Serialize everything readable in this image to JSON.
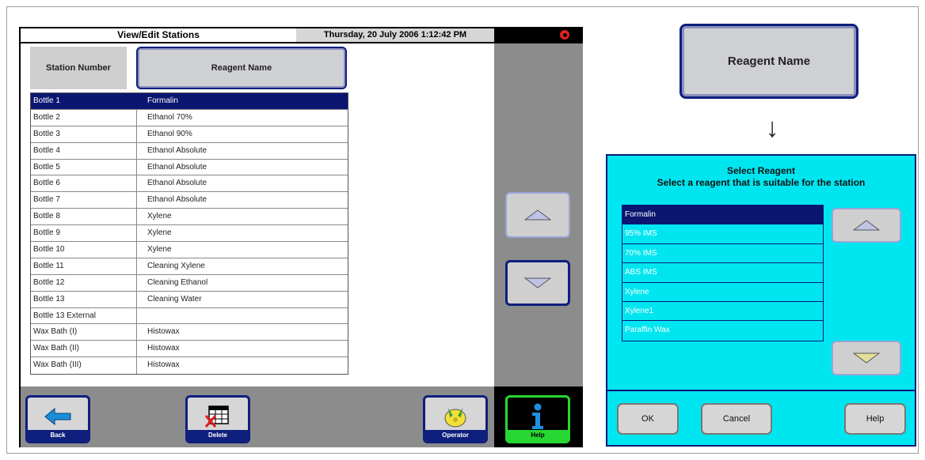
{
  "screen": {
    "title": "View/Edit Stations",
    "datetime": "Thursday, 20 July 2006 1:12:42 PM",
    "alarm_icon": "alarm-icon"
  },
  "table": {
    "headers": {
      "station": "Station Number",
      "reagent": "Reagent Name"
    },
    "rows": [
      {
        "station": "Bottle 1",
        "reagent": "Formalin",
        "selected": true
      },
      {
        "station": "Bottle 2",
        "reagent": "Ethanol 70%"
      },
      {
        "station": "Bottle 3",
        "reagent": "Ethanol 90%"
      },
      {
        "station": "Bottle 4",
        "reagent": "Ethanol Absolute"
      },
      {
        "station": "Bottle 5",
        "reagent": "Ethanol Absolute"
      },
      {
        "station": "Bottle 6",
        "reagent": "Ethanol Absolute"
      },
      {
        "station": "Bottle 7",
        "reagent": "Ethanol Absolute"
      },
      {
        "station": "Bottle 8",
        "reagent": "Xylene"
      },
      {
        "station": "Bottle 9",
        "reagent": "Xylene"
      },
      {
        "station": "Bottle 10",
        "reagent": "Xylene"
      },
      {
        "station": "Bottle 11",
        "reagent": "Cleaning Xylene"
      },
      {
        "station": "Bottle 12",
        "reagent": "Cleaning Ethanol"
      },
      {
        "station": "Bottle 13",
        "reagent": "Cleaning Water"
      },
      {
        "station": "Bottle 13 External",
        "reagent": ""
      },
      {
        "station": "Wax Bath (I)",
        "reagent": "Histowax"
      },
      {
        "station": "Wax Bath (II)",
        "reagent": "Histowax"
      },
      {
        "station": "Wax Bath (III)",
        "reagent": "Histowax"
      }
    ]
  },
  "toolbar": {
    "back_label": "Back",
    "delete_label": "Delete",
    "operator_label": "Operator",
    "help_label": "Help"
  },
  "callout": {
    "reagent_button_label": "Reagent Name",
    "arrow": "↓"
  },
  "dialog": {
    "title_line1": "Select Reagent",
    "title_line2": "Select a reagent that is suitable for the station",
    "items": [
      "Formalin",
      "95% IMS",
      "70% IMS",
      "ABS IMS",
      "Xylene",
      "Xylene1",
      "Paraffin Wax"
    ],
    "selected_index": 0,
    "ok_label": "OK",
    "cancel_label": "Cancel",
    "help_label": "Help"
  },
  "colors": {
    "selection": "#0a1670",
    "dialog_bg": "#00e6f0",
    "panel_gray": "#8c8c8c",
    "help_green": "#27d832"
  }
}
